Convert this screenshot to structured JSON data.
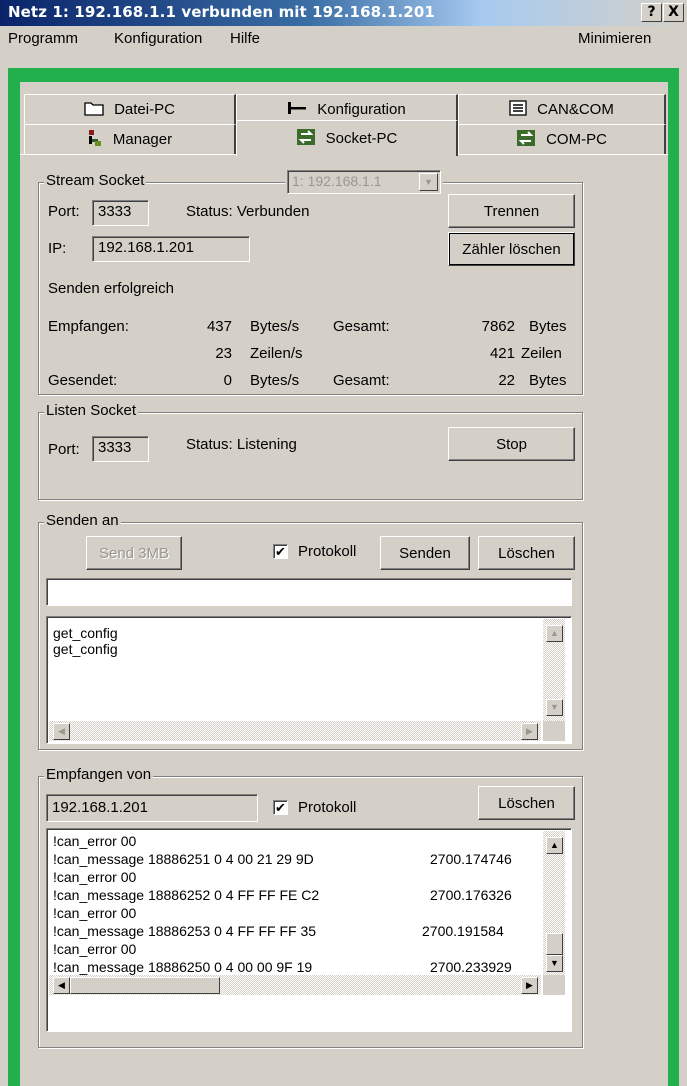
{
  "window": {
    "title": "Netz 1: 192.168.1.1  verbunden mit 192.168.1.201",
    "help_btn": "?",
    "close_btn": "X"
  },
  "menu": {
    "items": [
      "Programm",
      "Konfiguration",
      "Hilfe"
    ],
    "minimize": "Minimieren"
  },
  "tabs": {
    "row1": [
      {
        "label": "Datei-PC",
        "icon": "folder-icon"
      },
      {
        "label": "Konfiguration",
        "icon": "config-icon"
      },
      {
        "label": "CAN&COM",
        "icon": "list-icon"
      }
    ],
    "row2": [
      {
        "label": "Manager",
        "icon": "manager-icon"
      },
      {
        "label": "Socket-PC",
        "icon": "socket-icon",
        "active": true
      },
      {
        "label": "COM-PC",
        "icon": "socket-icon"
      }
    ]
  },
  "stream": {
    "legend": "Stream Socket",
    "network_select": "1: 192.168.1.1",
    "port_label": "Port:",
    "port": "3333",
    "status": "Status: Verbunden",
    "ip_label": "IP:",
    "ip": "192.168.1.201",
    "disconnect_btn": "Trennen",
    "clear_counter_btn": "Zähler löschen",
    "send_status": "Senden erfolgreich",
    "received_label": "Empfangen:",
    "received_rate": "437",
    "bytes_per_s": "Bytes/s",
    "total_label": "Gesamt:",
    "received_total": "7862",
    "bytes": "Bytes",
    "lines_rate": "23",
    "lines_per_s": "Zeilen/s",
    "lines_total": "421",
    "lines": "Zeilen",
    "sent_label": "Gesendet:",
    "sent_rate": "0",
    "sent_bytes_per_s": "Bytes/s",
    "sent_total_label": "Gesamt:",
    "sent_total": "22",
    "sent_bytes": "Bytes"
  },
  "listen": {
    "legend": "Listen Socket",
    "port_label": "Port:",
    "port": "3333",
    "status": "Status: Listening",
    "stop_btn": "Stop"
  },
  "send": {
    "legend": "Senden an",
    "send3mb_btn": "Send 3MB",
    "protocol_label": "Protokoll",
    "protocol_checked": true,
    "send_btn": "Senden",
    "clear_btn": "Löschen",
    "input_value": "",
    "log": [
      "get_config",
      "get_config"
    ]
  },
  "receive": {
    "legend": "Empfangen von",
    "source": "192.168.1.201",
    "protocol_label": "Protokoll",
    "protocol_checked": true,
    "clear_btn": "Löschen",
    "log": [
      {
        "msg": "!can_error 00",
        "time": ""
      },
      {
        "msg": "!can_message 18886251 0 4 00 21 29 9D",
        "time": "2700.174746"
      },
      {
        "msg": "!can_error 00",
        "time": ""
      },
      {
        "msg": "!can_message 18886252 0 4 FF FF FE C2",
        "time": "2700.176326"
      },
      {
        "msg": "!can_error 00",
        "time": ""
      },
      {
        "msg": "!can_message 18886253 0 4 FF FF FF 35",
        "time": "2700.191584"
      },
      {
        "msg": "!can_error 00",
        "time": ""
      },
      {
        "msg": "!can_message 18886250 0 4 00 00 9F 19",
        "time": "2700.233929"
      }
    ]
  }
}
